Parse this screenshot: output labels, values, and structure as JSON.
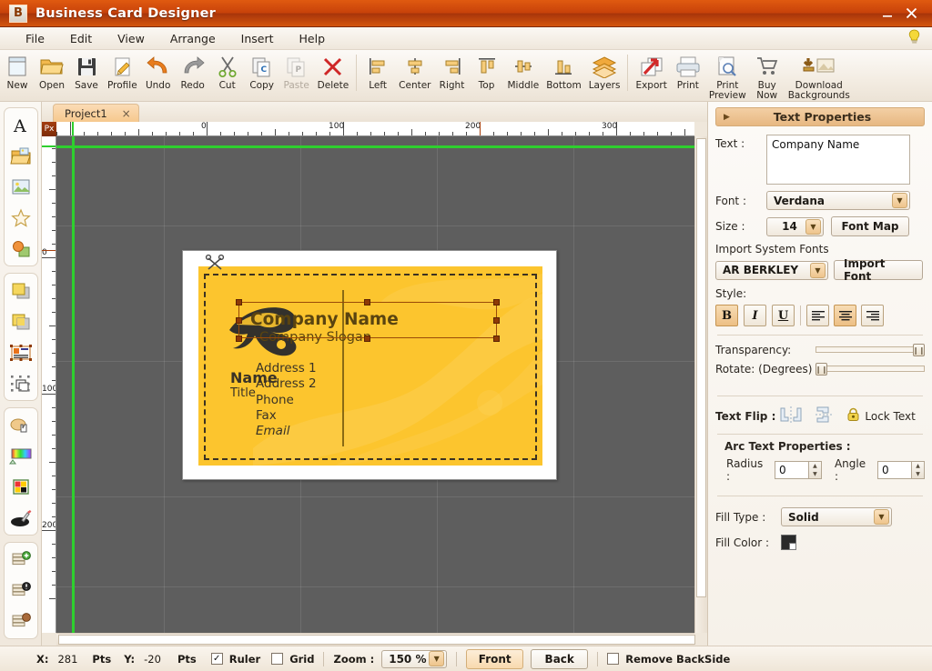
{
  "window": {
    "app_badge": "B",
    "title": "Business Card Designer",
    "minimize": "minimize-icon",
    "close": "close-icon"
  },
  "menu": {
    "items": [
      {
        "label": "File"
      },
      {
        "label": "Edit"
      },
      {
        "label": "View"
      },
      {
        "label": "Arrange"
      },
      {
        "label": "Insert"
      },
      {
        "label": "Help"
      }
    ],
    "lamp_icon": "lightbulb-icon"
  },
  "toolbar": {
    "groups": [
      {
        "buttons": [
          {
            "label": "New",
            "icon": "new-document-icon",
            "enabled": true
          },
          {
            "label": "Open",
            "icon": "open-folder-icon",
            "enabled": true
          },
          {
            "label": "Save",
            "icon": "floppy-disk-icon",
            "enabled": true
          },
          {
            "label": "Profile",
            "icon": "profile-pencil-icon",
            "enabled": true
          },
          {
            "label": "Undo",
            "icon": "undo-arrow-icon",
            "enabled": true
          },
          {
            "label": "Redo",
            "icon": "redo-arrow-icon",
            "enabled": true
          },
          {
            "label": "Cut",
            "icon": "scissors-icon",
            "enabled": true
          },
          {
            "label": "Copy",
            "icon": "copy-icon",
            "enabled": true
          },
          {
            "label": "Paste",
            "icon": "paste-icon",
            "enabled": false
          },
          {
            "label": "Delete",
            "icon": "delete-x-icon",
            "enabled": true
          }
        ]
      },
      {
        "buttons": [
          {
            "label": "Left",
            "icon": "align-left-icon",
            "enabled": true
          },
          {
            "label": "Center",
            "icon": "align-center-icon",
            "enabled": true
          },
          {
            "label": "Right",
            "icon": "align-right-icon",
            "enabled": true
          },
          {
            "label": "Top",
            "icon": "align-top-icon",
            "enabled": true
          },
          {
            "label": "Middle",
            "icon": "align-middle-icon",
            "enabled": true
          },
          {
            "label": "Bottom",
            "icon": "align-bottom-icon",
            "enabled": true
          },
          {
            "label": "Layers",
            "icon": "layers-stack-icon",
            "enabled": true
          }
        ]
      },
      {
        "buttons": [
          {
            "label": "Export",
            "icon": "export-arrow-icon",
            "enabled": true
          },
          {
            "label": "Print",
            "icon": "printer-icon",
            "enabled": true
          },
          {
            "label": "Print\nPreview",
            "icon": "print-preview-icon",
            "enabled": true
          },
          {
            "label": "Buy\nNow",
            "icon": "shopping-cart-icon",
            "enabled": true
          },
          {
            "label": "Download\nBackgrounds",
            "icon": "download-backgrounds-icon",
            "enabled": true
          }
        ]
      }
    ]
  },
  "rail": {
    "groups": [
      {
        "tools": [
          {
            "icon": "add-text-icon",
            "name": "text-tool"
          },
          {
            "icon": "open-image-folder-icon",
            "name": "open-image-tool"
          },
          {
            "icon": "insert-image-icon",
            "name": "insert-image-tool"
          },
          {
            "icon": "shape-star-icon",
            "name": "shape-tool"
          },
          {
            "icon": "clipart-icon",
            "name": "clipart-tool"
          }
        ]
      },
      {
        "tools": [
          {
            "icon": "bring-forward-icon",
            "name": "bring-forward-tool"
          },
          {
            "icon": "send-backward-icon",
            "name": "send-backward-tool"
          },
          {
            "icon": "group-objects-icon",
            "name": "group-objects-tool"
          },
          {
            "icon": "select-objects-icon",
            "name": "select-objects-tool"
          }
        ]
      },
      {
        "tools": [
          {
            "icon": "hand-pan-icon",
            "name": "pan-tool"
          },
          {
            "icon": "gradient-icon",
            "name": "gradient-tool"
          },
          {
            "icon": "color-palette-icon",
            "name": "palette-tool"
          },
          {
            "icon": "eyedropper-icon",
            "name": "eyedropper-tool"
          }
        ]
      },
      {
        "tools": [
          {
            "icon": "add-layer-icon",
            "name": "add-layer-tool"
          },
          {
            "icon": "delete-layer-icon",
            "name": "delete-layer-tool"
          },
          {
            "icon": "duplicate-layer-icon",
            "name": "duplicate-layer-tool"
          }
        ]
      }
    ]
  },
  "workspace": {
    "tab": {
      "label": "Project1",
      "close": "×"
    },
    "ruler_unit": "Px",
    "h_ruler_labels": [
      "0",
      "100",
      "200",
      "300"
    ],
    "v_ruler_labels": [
      "0",
      "100",
      "200"
    ]
  },
  "card": {
    "name": "Name",
    "title": "Title",
    "company": "Company Name",
    "slogan": "Company Slogan",
    "lines": [
      "Address 1",
      "Address 2",
      "Phone",
      "Fax"
    ],
    "email": "Email",
    "background_color": "#fcc52e",
    "text_color": "#5a4410",
    "logo_icon": "swirl-logo-icon",
    "scissors_icon": "scissors-cut-mark-icon"
  },
  "properties": {
    "header": "Text Properties",
    "text_label": "Text :",
    "text_value": "Company Name",
    "font_label": "Font :",
    "font_value": "Verdana",
    "size_label": "Size :",
    "size_value": "14",
    "font_map_button": "Font Map",
    "import_system_fonts": "Import System Fonts",
    "system_font_value": "AR BERKLEY",
    "import_font_button": "Import Font",
    "style_label": "Style:",
    "style_buttons": [
      {
        "label": "B",
        "name": "bold-button",
        "active": true
      },
      {
        "label": "I",
        "name": "italic-button",
        "active": false
      },
      {
        "label": "U",
        "name": "underline-button",
        "active": false
      }
    ],
    "align_buttons": [
      {
        "name": "align-left-button",
        "active": false
      },
      {
        "name": "align-center-button",
        "active": true
      },
      {
        "name": "align-right-button",
        "active": false
      }
    ],
    "transparency_label": "Transparency:",
    "transparency_value": 100,
    "rotate_label": "Rotate: (Degrees)",
    "rotate_value": 0,
    "text_flip_label": "Text Flip :",
    "flip_horizontal_icon": "flip-horizontal-icon",
    "flip_vertical_icon": "flip-vertical-icon",
    "lock_icon": "lock-icon",
    "lock_text_label": "Lock Text",
    "arc_header": "Arc Text Properties :",
    "radius_label": "Radius :",
    "radius_value": "0",
    "angle_label": "Angle :",
    "angle_value": "0",
    "fill_type_label": "Fill Type :",
    "fill_type_value": "Solid",
    "fill_color_label": "Fill Color :",
    "fill_color_value": "#2a2a2a"
  },
  "status": {
    "x_label": "X:",
    "x_value": "281",
    "x_unit": "Pts",
    "y_label": "Y:",
    "y_value": "-20",
    "y_unit": "Pts",
    "ruler_label": "Ruler",
    "ruler_checked": true,
    "grid_label": "Grid",
    "grid_checked": false,
    "zoom_label": "Zoom :",
    "zoom_value": "150 %",
    "front_button": "Front",
    "back_button": "Back",
    "remove_backside_label": "Remove BackSide",
    "remove_backside_checked": false
  }
}
